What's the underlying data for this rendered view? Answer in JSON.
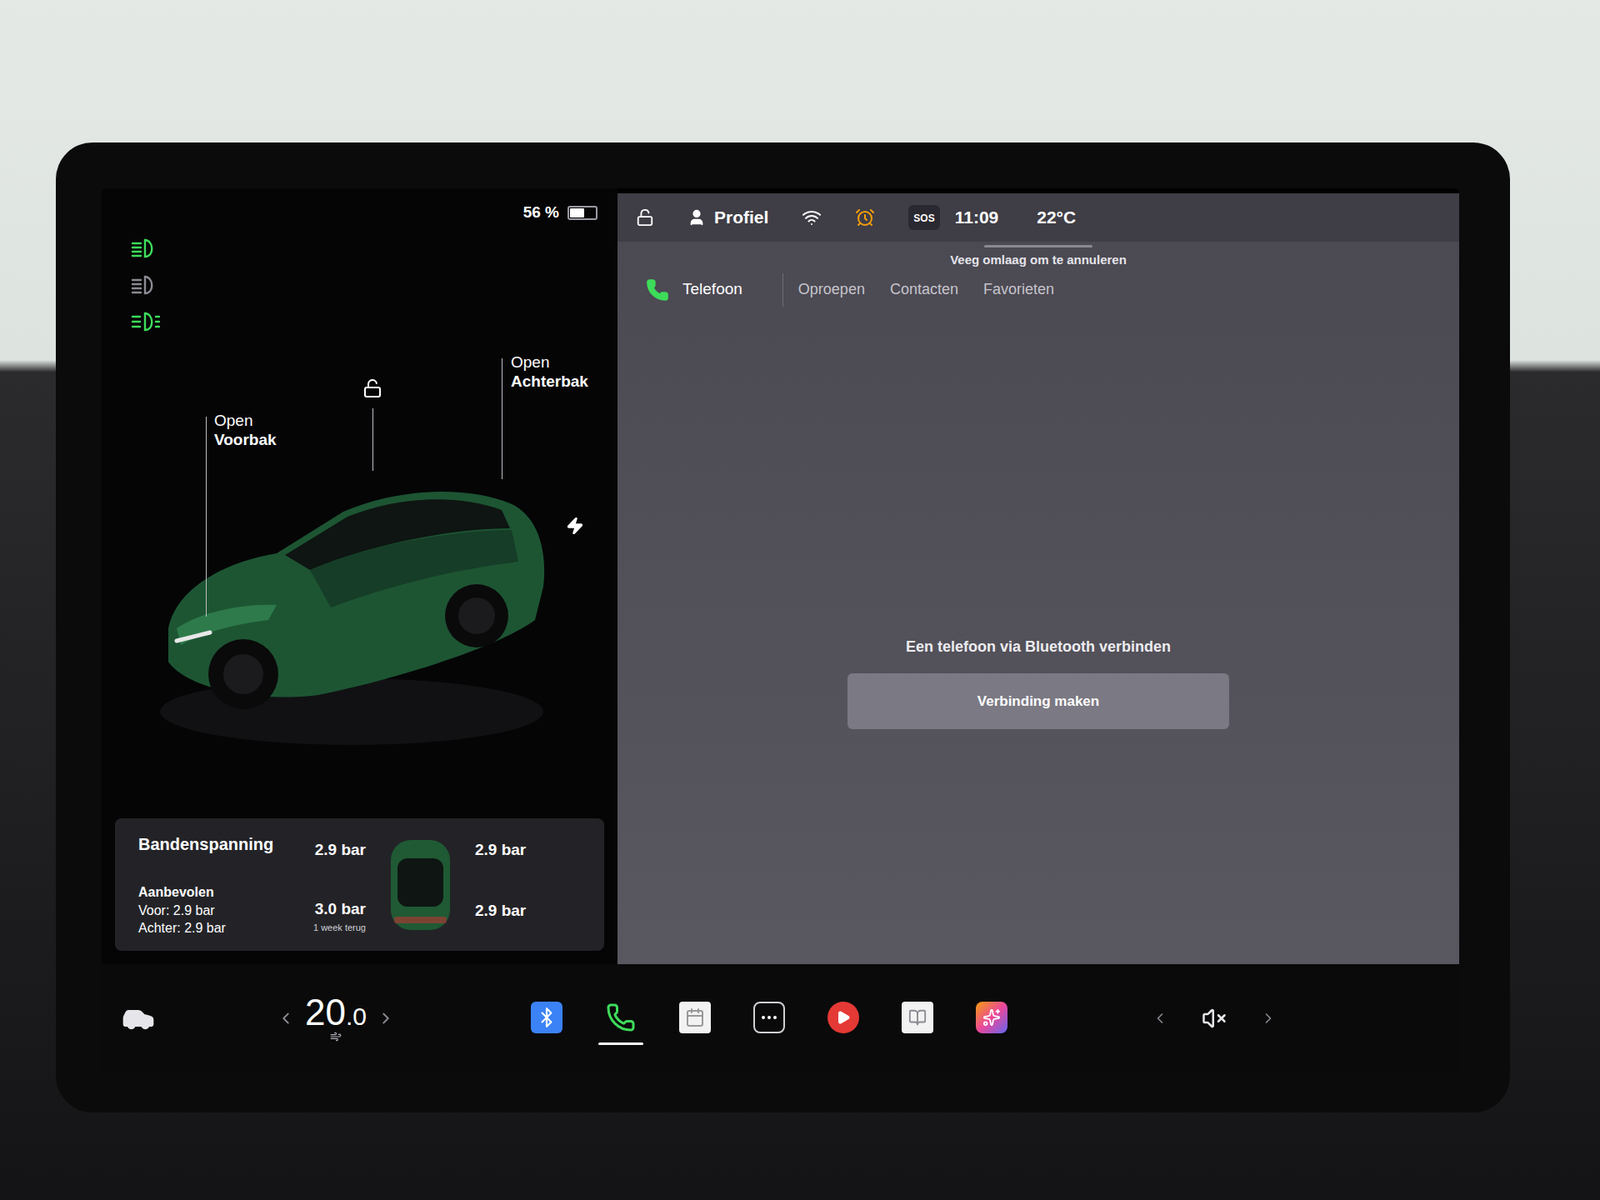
{
  "status": {
    "battery": "56 %",
    "battery_level": 0.56,
    "profile": "Profiel",
    "sos": "SOS",
    "time": "11:09",
    "temperature": "22°C"
  },
  "lights": [
    {
      "kind": "low-beam",
      "on": true
    },
    {
      "kind": "auto-high-beam",
      "on": false
    },
    {
      "kind": "parking",
      "on": true
    }
  ],
  "car": {
    "locked": false,
    "charging": true,
    "frunk": {
      "action": "Open",
      "label": "Voorbak"
    },
    "trunk": {
      "action": "Open",
      "label": "Achterbak"
    }
  },
  "tire_pressure": {
    "title": "Bandenspanning",
    "recommended_title": "Aanbevolen",
    "front": "Voor: 2.9 bar",
    "rear": "Achter: 2.9 bar",
    "tires": [
      {
        "position": "front-left",
        "reading": "2.9 bar",
        "note": ""
      },
      {
        "position": "front-right",
        "reading": "2.9 bar",
        "note": ""
      },
      {
        "position": "rear-left",
        "reading": "3.0 bar",
        "note": "1 week terug"
      },
      {
        "position": "rear-right",
        "reading": "2.9 bar",
        "note": ""
      }
    ]
  },
  "phone": {
    "title": "Telefoon",
    "hint": "Veeg omlaag om te annuleren",
    "tabs": [
      {
        "label": "Oproepen",
        "selected": false
      },
      {
        "label": "Contacten",
        "selected": false
      },
      {
        "label": "Favorieten",
        "selected": false
      }
    ],
    "message": "Een telefoon via Bluetooth verbinden",
    "button": "Verbinding maken"
  },
  "dock": {
    "temperature": "20",
    "temperature_decimal": ".0",
    "muted": true,
    "apps": [
      {
        "kind": "bluetooth",
        "selected": false
      },
      {
        "kind": "phone",
        "selected": true
      },
      {
        "kind": "calendar",
        "selected": false
      },
      {
        "kind": "more",
        "selected": false
      },
      {
        "kind": "music",
        "selected": false
      },
      {
        "kind": "manual",
        "selected": false
      },
      {
        "kind": "toybox",
        "selected": false
      }
    ]
  }
}
